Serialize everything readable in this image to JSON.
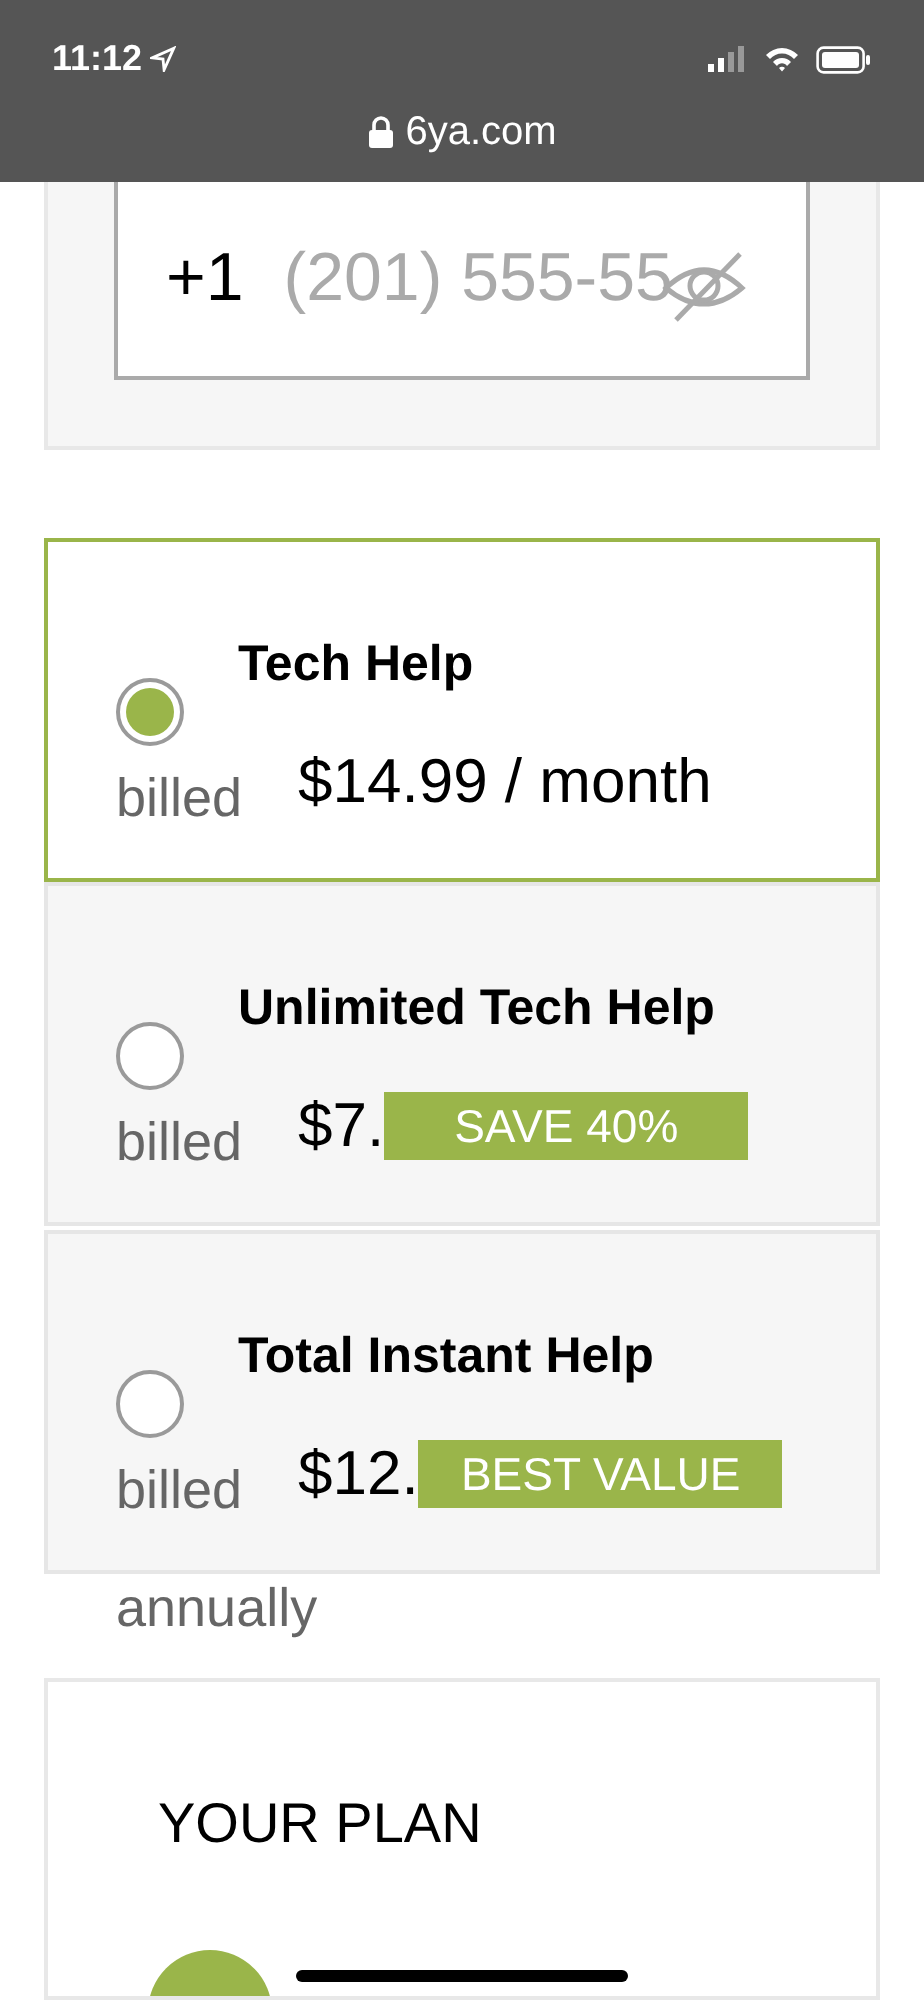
{
  "status_bar": {
    "time": "11:12",
    "url": "6ya.com"
  },
  "phone": {
    "country_code": "+1",
    "placeholder": "(201) 555-55"
  },
  "plans": [
    {
      "name": "Tech Help",
      "price": "$14.99 / month",
      "billing": [
        "billed"
      ],
      "selected": true
    },
    {
      "name": "Unlimited Tech Help",
      "price": "$7.",
      "billing": [
        "billed"
      ],
      "badge": "SAVE 40%",
      "selected": false
    },
    {
      "name": "Total Instant Help",
      "price": "$12.",
      "billing": [
        "billed",
        "annually"
      ],
      "badge": "BEST VALUE",
      "selected": false
    }
  ],
  "your_plan": {
    "title": "YOUR PLAN"
  }
}
